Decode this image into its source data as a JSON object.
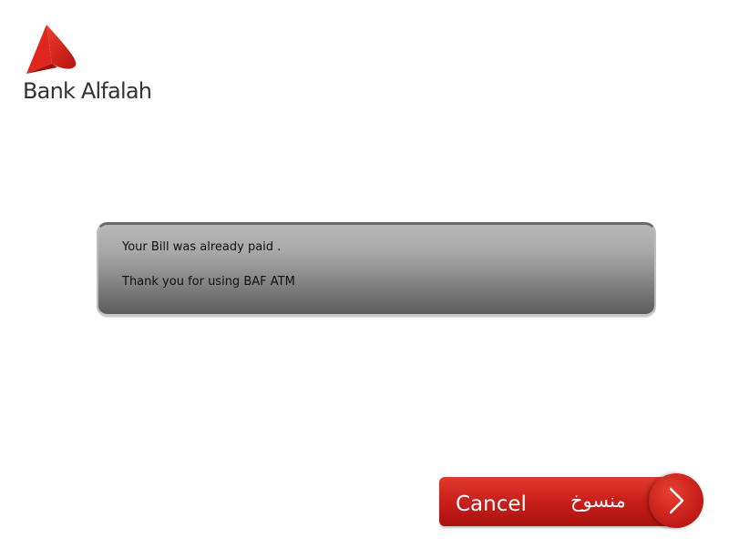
{
  "logo": {
    "name": "Bank Alfalah",
    "icon": "bank-alfalah-logo-mark",
    "brand_color": "#e0261f"
  },
  "message": {
    "line1": "Your Bill was already paid .",
    "line2": "Thank you for using BAF ATM"
  },
  "cancel_button": {
    "label": "Cancel",
    "label_urdu": "منسوخ",
    "icon": "chevron-right-icon",
    "color": "#c91f1b"
  }
}
